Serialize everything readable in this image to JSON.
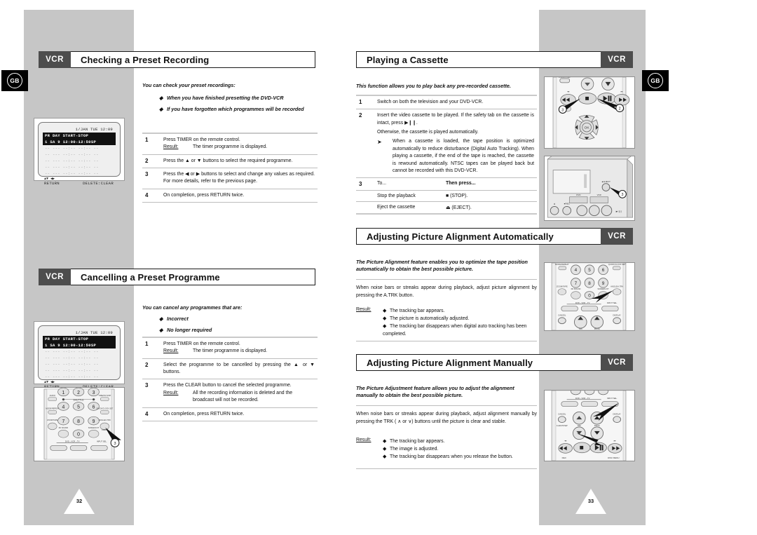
{
  "document": {
    "language_badge": "GB",
    "brand_chip": "VCR"
  },
  "left_page": {
    "page_number": "32",
    "sections": [
      {
        "chip": "VCR",
        "title": "Checking a Preset Recording",
        "intro": "You can check your preset recordings:",
        "bullets": [
          "When you have finished presetting the DVD-VCR",
          "If you have forgotten which programmes will be recorded"
        ],
        "steps": [
          {
            "num": "1",
            "text": "Press TIMER on the remote control.",
            "result_label": "Result:",
            "result_text": "The timer programme is displayed."
          },
          {
            "num": "2",
            "text": "Press the ▲ or ▼ buttons to select the required programme."
          },
          {
            "num": "3",
            "text": "Press the ◀ or ▶ buttons to select and change any values as required. For more details, refer to the previous page."
          },
          {
            "num": "4",
            "text": "On completion, press RETURN twice."
          }
        ],
        "osd": {
          "clock": "1/JAN TUE  12:09",
          "header": "PR DAY  START-STOP",
          "selected_row": "1 SA  9 12:00-12:50SP",
          "empty_rows": [
            "-- ---  --:-- --:-- --",
            "-- ---  --:-- --:-- --",
            "-- ---  --:-- --:-- --",
            "-- ---  --:-- --:-- --",
            "-- ---  --:-- --:-- --"
          ],
          "foot_icons": "▲▼ ◀▶",
          "foot_left": "RETURN",
          "foot_right": "DELETE:CLEAR"
        }
      },
      {
        "chip": "VCR",
        "title": "Cancelling a Preset Programme",
        "intro": "You can cancel any programmes that are:",
        "bullets": [
          "Incorrect",
          "No longer required"
        ],
        "steps": [
          {
            "num": "1",
            "text": "Press TIMER on the remote control.",
            "result_label": "Result:",
            "result_text": "The timer programme is displayed."
          },
          {
            "num": "2",
            "text": "Select the programme to be cancelled by pressing the ▲ or ▼ buttons."
          },
          {
            "num": "3",
            "text": "Press the CLEAR button to cancel the selected programme.",
            "result_label": "Result:",
            "result_text": "All the recording information is deleted and the broadcast will not be recorded."
          },
          {
            "num": "4",
            "text": "On completion, press RETURN twice."
          }
        ],
        "osd": {
          "clock": "1/JAN TUE  12:09",
          "header": "PR DAY  START-STOP",
          "selected_row": "1 SA  9 12:00-12:50SP",
          "empty_rows": [
            "-- ---  --:-- --:-- --",
            "-- ---  --:-- --:-- --",
            "-- ---  --:-- --:-- --",
            "-- ---  --:-- --:-- --",
            "-- ---  --:-- --:-- --"
          ],
          "foot_icons": "▲▼ ◀▶",
          "foot_left": "RETURN",
          "foot_right": "DELETE:CLEAR"
        },
        "remote_callout": "3"
      }
    ]
  },
  "right_page": {
    "page_number": "33",
    "sections": [
      {
        "chip": "VCR",
        "title": "Playing a Cassette",
        "intro": "This function allows you to play back any pre-recorded cassette.",
        "steps": [
          {
            "num": "1",
            "text": "Switch on both the television and your DVD-VCR."
          },
          {
            "num": "2",
            "text": "Insert the video cassette to be played. If the safety tab on the cassette is intact, press ▶❙❙.",
            "extra": "Otherwise, the cassette is played automatically.",
            "note": "When a cassette is loaded, the tape position is optimized automatically to reduce disturbance (Digital Auto Tracking). When playing a cassette, if the end of the tape is reached, the cassette is rewound automatically. NTSC tapes can be played back but cannot be recorded with this DVD-VCR."
          },
          {
            "num": "3",
            "col1": "To...",
            "col2": "Then press...",
            "rows": [
              {
                "action": "Stop the playback",
                "press": "■ (STOP)."
              },
              {
                "action": "Eject the cassette",
                "press": "⏏ (EJECT)."
              }
            ]
          }
        ],
        "remote_callouts": [
          "2",
          "3"
        ],
        "device_callout": "3"
      },
      {
        "chip": "VCR",
        "title": "Adjusting Picture Alignment Automatically",
        "intro": "The Picture Alignment feature enables you to optimize the tape position automatically to obtain the best possible picture.",
        "paragraph": "When noise bars or streaks appear during playback, adjust picture alignment by pressing the A.TRK button.",
        "result_label": "Result:",
        "results": [
          "The tracking bar appears.",
          "The picture is automatically adjusted.",
          "The tracking bar disappears when digital auto tracking has been completed."
        ]
      },
      {
        "chip": "VCR",
        "title": "Adjusting Picture Alignment Manually",
        "intro": "The Picture Adjustment feature allows you to adjust the alignment manually to obtain the best possible picture.",
        "paragraph": "When noise bars or streaks appear during playback, adjust alignment manually by pressing the TRK ( ∧ or ∨) buttons until the picture is clear and stable.",
        "result_label": "Result:",
        "results": [
          "The tracking bar appears.",
          "The image is adjusted.",
          "The tracking bar disappears when you release the button."
        ]
      }
    ]
  },
  "colors": {
    "band": "#c6c6c6",
    "chip": "#4d4d4d",
    "rule": "#bdbdbd",
    "text": "#111111"
  }
}
